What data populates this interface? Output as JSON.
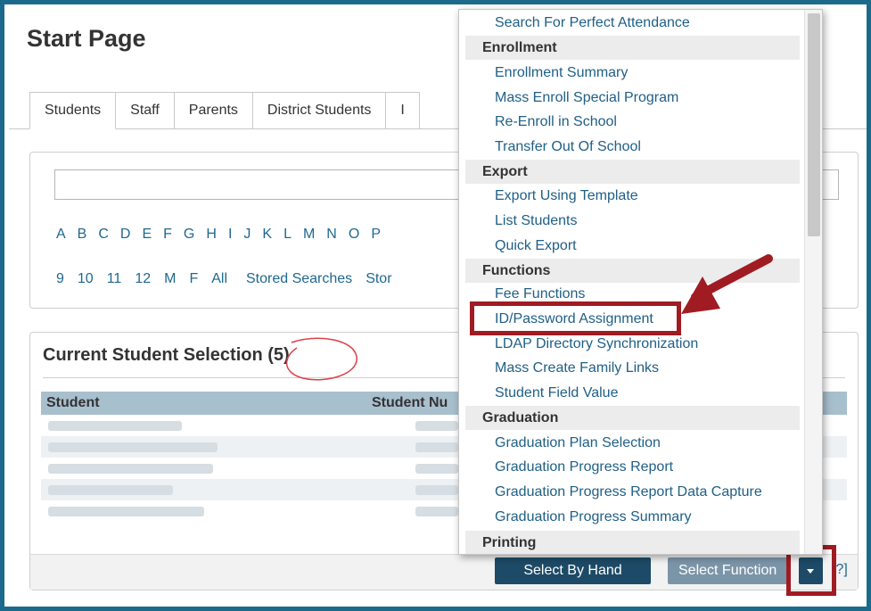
{
  "page_title": "Start Page",
  "tabs": [
    "Students",
    "Staff",
    "Parents",
    "District Students",
    "I"
  ],
  "search": {
    "value": "",
    "placeholder": ""
  },
  "letters": [
    "A",
    "B",
    "C",
    "D",
    "E",
    "F",
    "G",
    "H",
    "I",
    "J",
    "K",
    "L",
    "M",
    "N",
    "O",
    "P"
  ],
  "quick_links": [
    "9",
    "10",
    "11",
    "12",
    "M",
    "F",
    "All",
    "Stored Searches",
    "Stor"
  ],
  "selection": {
    "title": "Current Student Selection (5)",
    "columns": [
      "Student",
      "Student Nu"
    ],
    "row_count": 5
  },
  "buttons": {
    "select_by_hand": "Select By Hand",
    "select_function": "Select Function",
    "help": "[?]"
  },
  "dropdown": {
    "top_item": "Search For Perfect Attendance",
    "sections": [
      {
        "heading": "Enrollment",
        "items": [
          "Enrollment Summary",
          "Mass Enroll Special Program",
          "Re-Enroll in School",
          "Transfer Out Of School"
        ]
      },
      {
        "heading": "Export",
        "items": [
          "Export Using Template",
          "List Students",
          "Quick Export"
        ]
      },
      {
        "heading": "Functions",
        "items": [
          "Fee Functions",
          "ID/Password Assignment",
          "LDAP Directory Synchronization",
          "Mass Create Family Links",
          "Student Field Value"
        ]
      },
      {
        "heading": "Graduation",
        "items": [
          "Graduation Plan Selection",
          "Graduation Progress Report",
          "Graduation Progress Report Data Capture",
          "Graduation Progress Summary"
        ]
      },
      {
        "heading": "Printing",
        "items": []
      }
    ]
  },
  "colors": {
    "frame": "#1c6a8b",
    "highlight": "#a01b22",
    "link": "#1f6890",
    "primary_button": "#1d4a66"
  }
}
